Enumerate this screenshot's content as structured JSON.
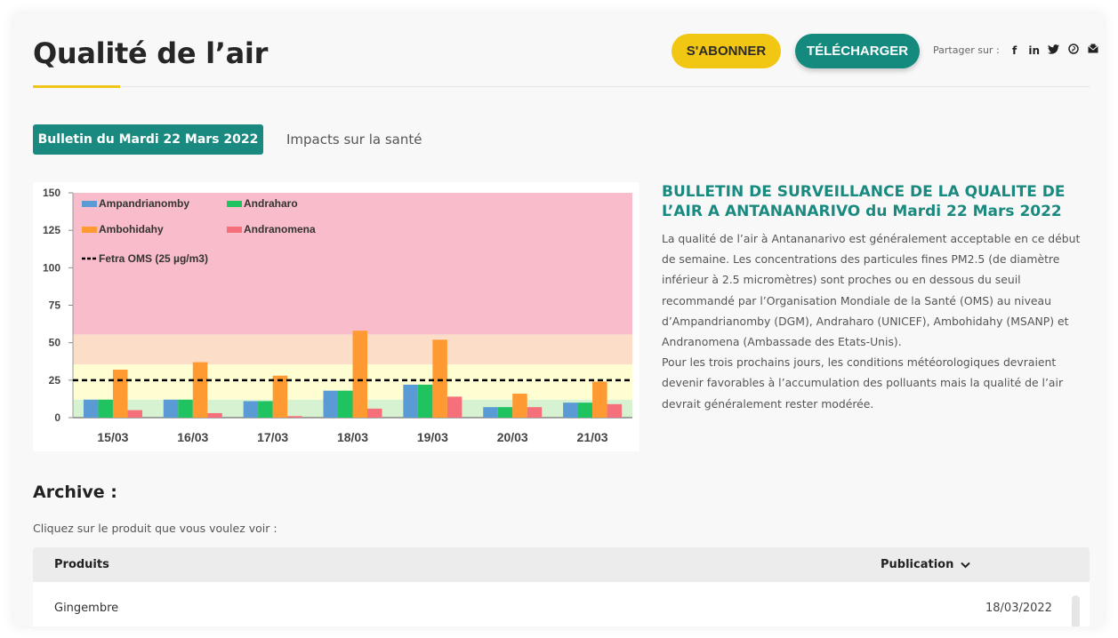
{
  "header": {
    "title": "Qualité de l’air",
    "subscribe_label": "S'ABONNER",
    "download_label": "TÉLÉCHARGER",
    "share_label": "Partager sur :",
    "share_icons": [
      {
        "name": "facebook-icon",
        "glyph": "f"
      },
      {
        "name": "linkedin-icon",
        "glyph": "in"
      },
      {
        "name": "twitter-icon",
        "glyph": "🐦"
      },
      {
        "name": "pinterest-icon",
        "glyph": "℗"
      },
      {
        "name": "email-icon",
        "glyph": "✉"
      }
    ]
  },
  "tabs": {
    "active": "Bulletin du Mardi 22 Mars 2022",
    "inactive": "Impacts sur la santé"
  },
  "bulletin": {
    "title": "BULLETIN DE SURVEILLANCE DE LA QUALITE DE L’AIR A ANTANANARIVO du Mardi 22 Mars 2022",
    "paragraph1": "La qualité de l’air à Antananarivo est généralement acceptable en ce début de semaine. Les concentrations des particules fines PM2.5 (de diamètre inférieur à 2.5 micromètres) sont proches ou en dessous du seuil recommandé par l’Organisation Mondiale de la Santé (OMS) au niveau d’Ampandrianomby (DGM), Andraharo (UNICEF), Ambohidahy (MSANP) et Andranomena (Ambassade des Etats-Unis).",
    "paragraph2": "Pour les trois prochains jours, les conditions météorologiques devraient devenir favorables à l’accumulation des polluants mais la qualité de l’air devrait généralement rester modérée."
  },
  "archive": {
    "title": "Archive :",
    "hint": "Cliquez sur le produit que vous voulez voir :",
    "columns": [
      "Produits",
      "Publication"
    ],
    "rows": [
      {
        "product": "Gingembre",
        "date": "18/03/2022"
      }
    ]
  },
  "chart_data": {
    "type": "bar",
    "title": "",
    "xlabel": "",
    "ylabel": "",
    "ylim": [
      0,
      150
    ],
    "yticks": [
      0,
      25,
      50,
      75,
      100,
      125,
      150
    ],
    "categories": [
      "15/03",
      "16/03",
      "17/03",
      "18/03",
      "19/03",
      "20/03",
      "21/03"
    ],
    "series": [
      {
        "name": "Ampandrianomby",
        "color": "#5b9bd5",
        "values": [
          12,
          12,
          11,
          18,
          22,
          7,
          10
        ]
      },
      {
        "name": "Andraharo",
        "color": "#1fc35f",
        "values": [
          12,
          12,
          11,
          18,
          22,
          7,
          10
        ]
      },
      {
        "name": "Ambohidahy",
        "color": "#ff9a33",
        "values": [
          32,
          37,
          28,
          58,
          52,
          16,
          24
        ]
      },
      {
        "name": "Andranomena",
        "color": "#f5707a",
        "values": [
          5,
          3,
          1,
          6,
          14,
          7,
          9
        ]
      }
    ],
    "reference_line": {
      "name": "Fetra OMS (25 µg/m3)",
      "value": 25,
      "style": "dashed",
      "color": "#000000"
    },
    "background_bands": [
      {
        "from": 0,
        "to": 12,
        "color": "#d7f2d0"
      },
      {
        "from": 12,
        "to": 35.5,
        "color": "#fffed3"
      },
      {
        "from": 35.5,
        "to": 55.5,
        "color": "#fcddc8"
      },
      {
        "from": 55.5,
        "to": 150,
        "color": "#f8bcca"
      }
    ],
    "legend_placement": "top-left inside",
    "grid": false
  }
}
